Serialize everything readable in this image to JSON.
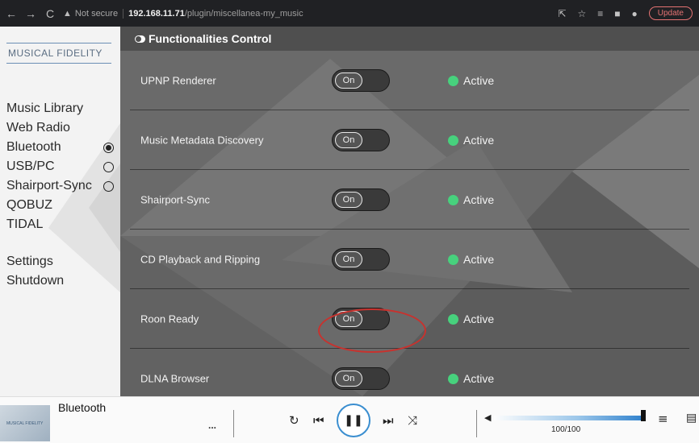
{
  "browser": {
    "security_label": "Not secure",
    "host": "192.168.11.71",
    "path": "/plugin/miscellanea-my_music",
    "update_label": "Update"
  },
  "sidebar": {
    "logo": "MUSICAL FIDELITY",
    "items": [
      {
        "label": "Music Library"
      },
      {
        "label": "Web Radio"
      },
      {
        "label": "Bluetooth",
        "radio": "selected"
      },
      {
        "label": "USB/PC",
        "radio": "unselected"
      },
      {
        "label": "Shairport-Sync",
        "radio": "unselected"
      },
      {
        "label": "QOBUZ"
      },
      {
        "label": "TIDAL"
      },
      {
        "label": "Settings"
      },
      {
        "label": "Shutdown"
      }
    ]
  },
  "main": {
    "title": "Functionalities Control",
    "switch_label": "On",
    "rows": [
      {
        "label": "UPNP Renderer",
        "status": "Active"
      },
      {
        "label": "Music Metadata Discovery",
        "status": "Active"
      },
      {
        "label": "Shairport-Sync",
        "status": "Active"
      },
      {
        "label": "CD Playback and Ripping",
        "status": "Active"
      },
      {
        "label": "Roon Ready",
        "status": "Active",
        "highlighted": true
      },
      {
        "label": "DLNA Browser",
        "status": "Active"
      }
    ],
    "status_color": "#47d17d",
    "highlight_color": "#c8322e"
  },
  "player": {
    "source": "Bluetooth",
    "thumb_text": "MUSICAL FIDELITY",
    "more_label": "...",
    "volume_text": "100/100",
    "volume_level": 1.0
  }
}
